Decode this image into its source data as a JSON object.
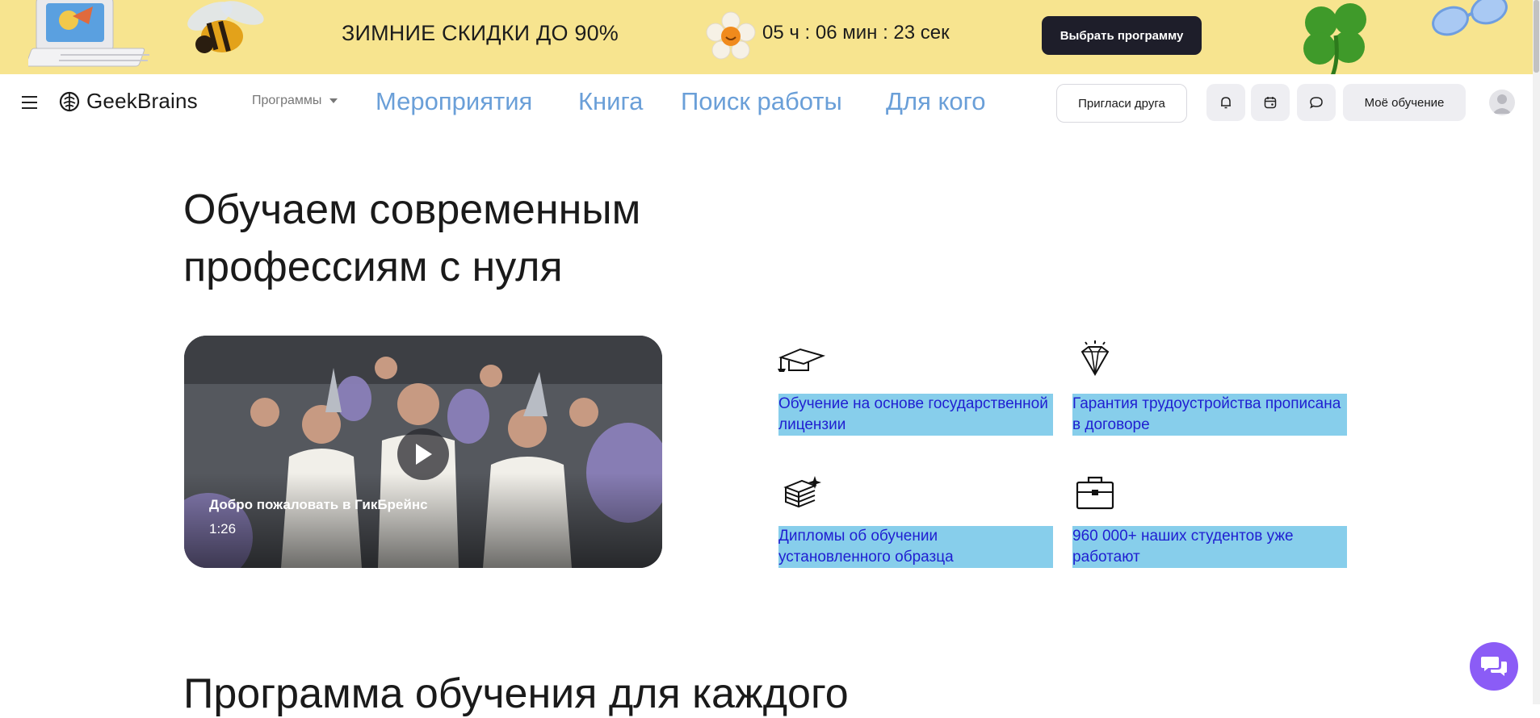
{
  "promo": {
    "text": "ЗИМНИЕ СКИДКИ ДО 90%",
    "timer": "05 ч : 06 мин : 23 сек",
    "cta_label": "Выбрать программу"
  },
  "nav": {
    "logo_text": "GeekBrains",
    "programs_label": "Программы",
    "links": [
      "Мероприятия",
      "Книга",
      "Поиск работы",
      "Для кого"
    ],
    "invite_label": "Пригласи друга",
    "my_learning_label": "Моё обучение"
  },
  "hero": {
    "title_line1": "Обучаем современным",
    "title_line2": "профессиям с нуля"
  },
  "video": {
    "caption": "Добро пожаловать в ГикБрейнс",
    "duration": "1:26"
  },
  "features": [
    {
      "icon": "graduation-cap-icon",
      "text": "Обучение на основе государственной лицензии"
    },
    {
      "icon": "diamond-icon",
      "text": "Гарантия трудоустройства прописана в договоре"
    },
    {
      "icon": "diploma-stack-icon",
      "text": "Дипломы об обучении установленного образца"
    },
    {
      "icon": "briefcase-icon",
      "text": "960 000+ наших студентов уже работают"
    }
  ],
  "next_section": {
    "title": "Программа обучения для каждого"
  },
  "colors": {
    "promo_bg": "#f7e48f",
    "nav_link": "#6a9fd8",
    "feature_highlight": "#87ceeb",
    "feature_text": "#1f1fd1",
    "chat_button": "#8b5cf6"
  }
}
